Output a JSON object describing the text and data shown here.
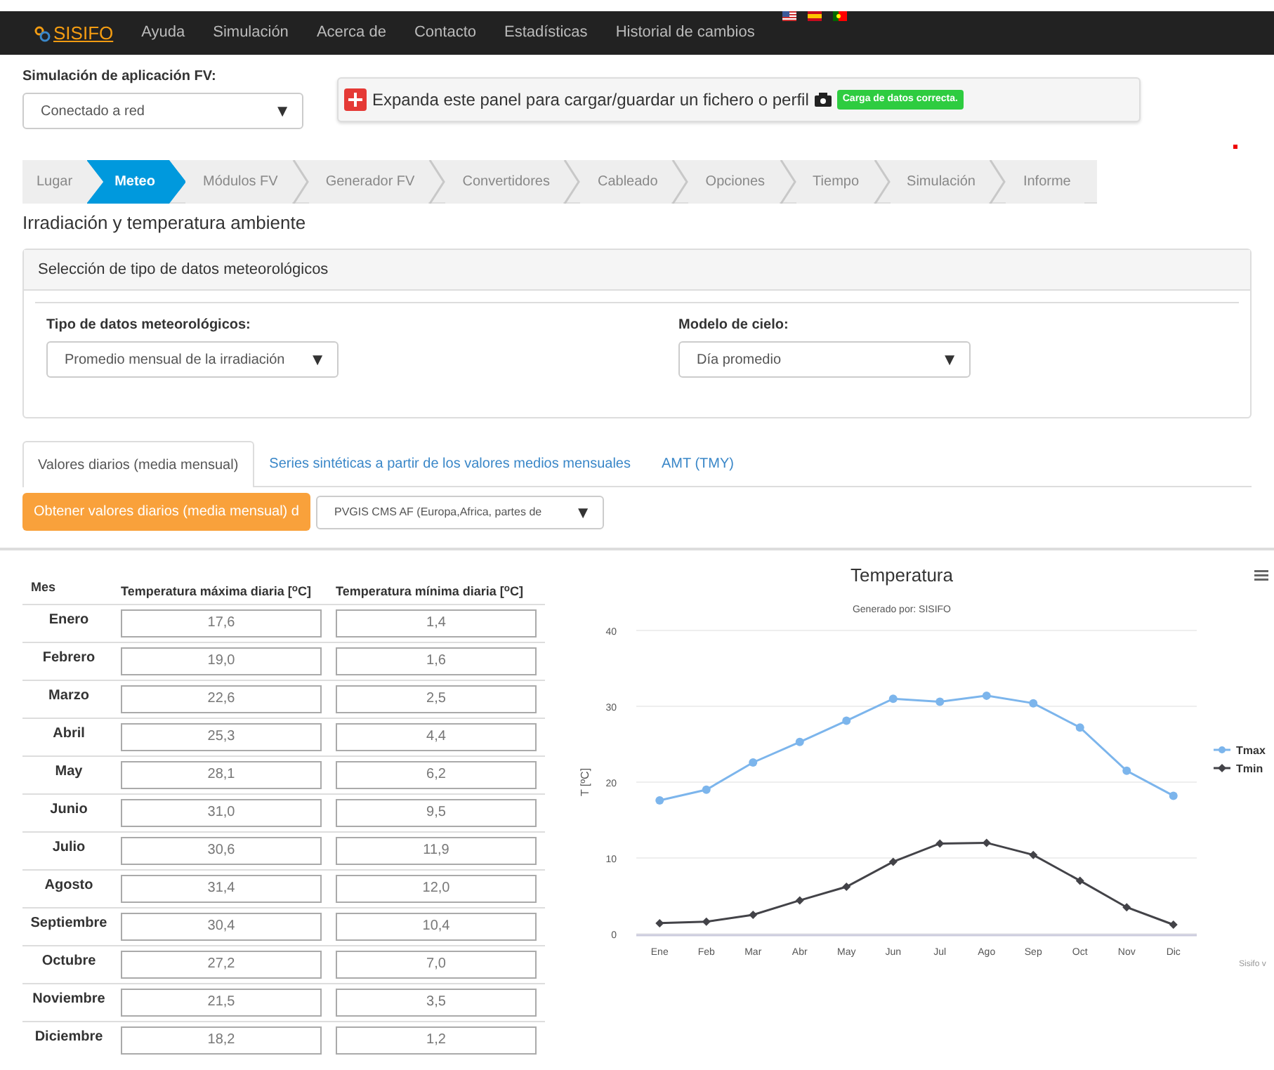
{
  "navbar": {
    "brand": "SISIFO",
    "links": [
      "Ayuda",
      "Simulación",
      "Acerca de",
      "Contacto",
      "Estadísticas",
      "Historial de cambios"
    ],
    "flags": [
      {
        "kind": "us"
      },
      {
        "kind": "es"
      },
      {
        "kind": "pt"
      }
    ]
  },
  "app_type": {
    "label": "Simulación de aplicación FV:",
    "value": "Conectado a red",
    "caret": "▼"
  },
  "file_panel": {
    "text": "Expanda este panel para cargar/guardar un fichero o perfil",
    "badge": "Carga de datos correcta."
  },
  "steps": [
    {
      "label": "Lugar",
      "selected": false
    },
    {
      "label": "Meteo",
      "selected": true
    },
    {
      "label": "Módulos FV",
      "selected": false
    },
    {
      "label": "Generador FV",
      "selected": false
    },
    {
      "label": "Convertidores",
      "selected": false
    },
    {
      "label": "Cableado",
      "selected": false
    },
    {
      "label": "Opciones",
      "selected": false
    },
    {
      "label": "Tiempo",
      "selected": false
    },
    {
      "label": "Simulación",
      "selected": false
    },
    {
      "label": "Informe",
      "selected": false
    }
  ],
  "section_title": "Irradiación y temperatura ambiente",
  "meteo_panel": {
    "title": "Selección de tipo de datos meteorológicos",
    "fields": [
      {
        "label": "Tipo de datos meteorológicos:",
        "value": "Promedio mensual de la irradiación",
        "caret": "▼"
      },
      {
        "label": "Modelo de cielo:",
        "value": "Día promedio",
        "caret": "▼"
      }
    ]
  },
  "data_tabs": [
    {
      "label": "Valores diarios (media mensual)",
      "selected": true
    },
    {
      "label": "Series sintéticas a partir de los valores medios mensuales",
      "selected": false
    },
    {
      "label": "AMT (TMY)",
      "selected": false
    }
  ],
  "fetch_button": "Obtener valores diarios (media mensual) d",
  "source_select": {
    "value": "PVGIS CMS AF (Europa,Africa, partes de",
    "caret": "▼"
  },
  "table": {
    "columns": [
      "Mes",
      "Temperatura máxima diaria [$^{o}$C]",
      "Temperatura mínima diaria [$^{o}$C]"
    ],
    "rows": [
      {
        "month": "Enero",
        "tmax": "17,6",
        "tmin": "1,4"
      },
      {
        "month": "Febrero",
        "tmax": "19,0",
        "tmin": "1,6"
      },
      {
        "month": "Marzo",
        "tmax": "22,6",
        "tmin": "2,5"
      },
      {
        "month": "Abril",
        "tmax": "25,3",
        "tmin": "4,4"
      },
      {
        "month": "May",
        "tmax": "28,1",
        "tmin": "6,2"
      },
      {
        "month": "Junio",
        "tmax": "31,0",
        "tmin": "9,5"
      },
      {
        "month": "Julio",
        "tmax": "30,6",
        "tmin": "11,9"
      },
      {
        "month": "Agosto",
        "tmax": "31,4",
        "tmin": "12,0"
      },
      {
        "month": "Septiembre",
        "tmax": "30,4",
        "tmin": "10,4"
      },
      {
        "month": "Octubre",
        "tmax": "27,2",
        "tmin": "7,0"
      },
      {
        "month": "Noviembre",
        "tmax": "21,5",
        "tmin": "3,5"
      },
      {
        "month": "Diciembre",
        "tmax": "18,2",
        "tmin": "1,2"
      }
    ]
  },
  "chart": {
    "credits": "Sisifo v",
    "chart_data": {
      "type": "line",
      "title": "Temperatura",
      "subtitle": "Generado por: SISIFO",
      "ylabel": "T [ºC]",
      "categories": [
        "Ene",
        "Feb",
        "Mar",
        "Abr",
        "May",
        "Jun",
        "Jul",
        "Ago",
        "Sep",
        "Oct",
        "Nov",
        "Dic"
      ],
      "ylim": [
        0,
        40
      ],
      "yticks": [
        0,
        10,
        20,
        30,
        40
      ],
      "grid": true,
      "legend": true,
      "series": [
        {
          "name": "Tmax",
          "color": "#7cb5ec",
          "marker": "circle",
          "values": [
            17.6,
            19.0,
            22.6,
            25.3,
            28.1,
            31.0,
            30.6,
            31.4,
            30.4,
            27.2,
            21.5,
            18.2
          ]
        },
        {
          "name": "Tmin",
          "color": "#434348",
          "marker": "diamond",
          "values": [
            1.4,
            1.6,
            2.5,
            4.4,
            6.2,
            9.5,
            11.9,
            12.0,
            10.4,
            7.0,
            3.5,
            1.2
          ]
        }
      ]
    }
  }
}
